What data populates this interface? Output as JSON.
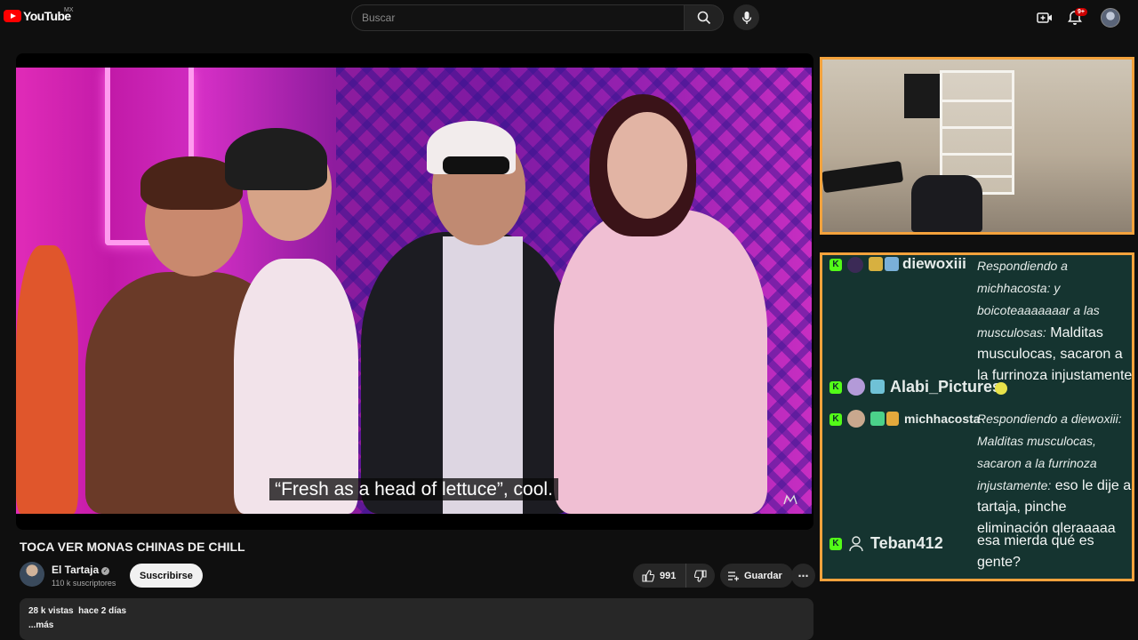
{
  "header": {
    "logo_text": "YouTube",
    "logo_country": "MX",
    "search_placeholder": "Buscar",
    "notifications_badge": "9+"
  },
  "player": {
    "subtitle": "“Fresh as a head of lettuce”, cool."
  },
  "video": {
    "title": "TOCA VER MONAS CHINAS DE CHILL",
    "channel_name": "El Tartaja",
    "subscribers": "110 k suscriptores",
    "subscribe_label": "Suscribirse",
    "likes": "991",
    "save_label": "Guardar",
    "views": "28 k vistas",
    "date": "hace 2 días",
    "more_label": "...más"
  },
  "chat": {
    "messages": [
      {
        "user": "diewoxiii",
        "reply_prefix": "Respondiendo a michhacosta: y boicoteaaaaaaar a las musculosas:",
        "text": "Malditas musculocas, sacaron a la furrinoza injustamente"
      },
      {
        "user": "Alabi_Pictures",
        "reply_prefix": "",
        "text": ""
      },
      {
        "user": "michhacosta",
        "reply_prefix": "Respondiendo a diewoxiii: Malditas musculocas, sacaron a la furrinoza injustamente:",
        "text": "eso le dije al tartaja, pinche eliminación qleraaaaa"
      },
      {
        "user": "Teban412",
        "reply_prefix": "",
        "text": "esa mierda qué es gente?"
      }
    ]
  },
  "colors": {
    "accent": "#ff0000",
    "chat_border": "#f3a23c",
    "chat_bg": "#153430",
    "kick_green": "#53fc18"
  }
}
